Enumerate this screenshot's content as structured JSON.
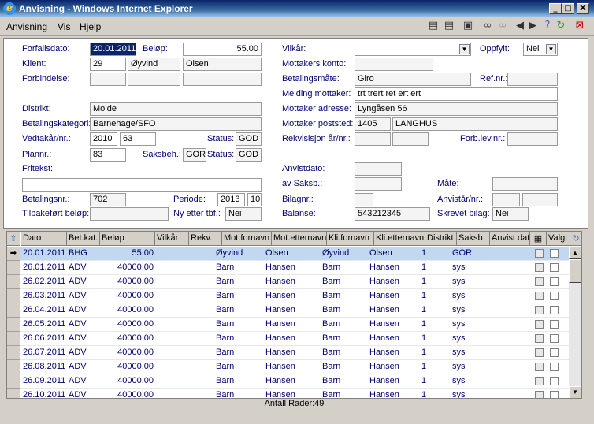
{
  "window": {
    "title": "Anvisning - Windows Internet Explorer",
    "min": "_",
    "max": "□",
    "close": "X"
  },
  "menu": [
    "Anvisning",
    "Vis",
    "Hjelp"
  ],
  "colors": {
    "label": "#00006e",
    "selected_row": "#c2d8f0"
  },
  "toolbar": {
    "icons": [
      "printer-icon",
      "printer-icon",
      "save-icon",
      "binoculars-icon",
      "binoculars-gray-icon",
      "prev-icon",
      "next-icon",
      "help-icon",
      "refresh-icon",
      "close-icon"
    ]
  },
  "form": {
    "l_forfallsdato": "Forfallsdato:",
    "forfallsdato": "20.01.2011",
    "l_belop": "Beløp:",
    "belop": "55.00",
    "l_vilkar": "Vilkår:",
    "vilkar": "",
    "l_oppfylt": "Oppfylt:",
    "oppfylt": "Nei",
    "l_klient": "Klient:",
    "klient_nr": "29",
    "klient_fornavn": "Øyvind",
    "klient_etternavn": "Olsen",
    "l_mottakers_konto": "Mottakers konto:",
    "mottakers_konto": "",
    "l_forbindelse": "Forbindelse:",
    "l_betalingsmate": "Betalingsmåte:",
    "betalingsmate": "Giro",
    "l_refnr": "Ref.nr.:",
    "refnr": "",
    "l_melding": "Melding mottaker:",
    "melding": "trt trert ret ert ert",
    "l_distrikt": "Distrikt:",
    "distrikt": "Molde",
    "l_mottaker_adresse": "Mottaker adresse:",
    "mottaker_adresse": "Lyngåsen 56",
    "l_betalingskategori": "Betalingskategori:",
    "betalingskategori": "Barnehage/SFO",
    "l_mottaker_poststed": "Mottaker poststed:",
    "postnr": "1405",
    "poststed": "LANGHUS",
    "l_vedtakar": "Vedtakår/nr.:",
    "vedtak_ar": "2010",
    "vedtak_nr": "63",
    "l_status": "Status:",
    "status1": "GOD",
    "l_rekvisisjon": "Rekvisisjon år/nr.:",
    "l_forblevnr": "Forb.lev.nr.:",
    "l_plannr": "Plannr.:",
    "plannr": "83",
    "l_saksbeh": "Saksbeh.:",
    "saksbeh": "GOR",
    "l_status2": "Status:",
    "status2": "GOD",
    "l_fritekst": "Fritekst:",
    "fritekst": "",
    "l_anvistdato": "Anvistdato:",
    "l_avsaksb": "av Saksb.:",
    "l_mate": "Måte:",
    "l_betalingsnr": "Betalingsnr.:",
    "betalingsnr": "702",
    "l_periode": "Periode:",
    "periode_ar": "2013",
    "periode_nr": "10",
    "l_bilagnr": "Bilagnr.:",
    "l_anvistar": "Anvistår/nr.:",
    "l_tilbakefort": "Tilbakeført beløp:",
    "l_nyetter": "Ny etter tbf.:",
    "nyetter": "Nei",
    "l_balanse": "Balanse:",
    "balanse": "543212345",
    "l_skrevet": "Skrevet bilag:",
    "skrevet": "Nei"
  },
  "grid": {
    "headers": [
      "Dato",
      "Bet.kat.",
      "Beløp",
      "Vilkår",
      "Rekv.",
      "Mot.fornavn",
      "Mot.etternavn",
      "Kli.fornavn",
      "Kli.etternavn",
      "Distrikt",
      "Saksb.",
      "Anvist dato",
      "Valgt"
    ],
    "rows": [
      [
        "20.01.2011",
        "BHG",
        "55.00",
        "",
        "",
        "Øyvind",
        "Olsen",
        "Øyvind",
        "Olsen",
        "1",
        "GOR"
      ],
      [
        "26.01.2011",
        "ADV",
        "40000.00",
        "",
        "",
        "Barn",
        "Hansen",
        "Barn",
        "Hansen",
        "1",
        "sys"
      ],
      [
        "26.02.2011",
        "ADV",
        "40000.00",
        "",
        "",
        "Barn",
        "Hansen",
        "Barn",
        "Hansen",
        "1",
        "sys"
      ],
      [
        "26.03.2011",
        "ADV",
        "40000.00",
        "",
        "",
        "Barn",
        "Hansen",
        "Barn",
        "Hansen",
        "1",
        "sys"
      ],
      [
        "26.04.2011",
        "ADV",
        "40000.00",
        "",
        "",
        "Barn",
        "Hansen",
        "Barn",
        "Hansen",
        "1",
        "sys"
      ],
      [
        "26.05.2011",
        "ADV",
        "40000.00",
        "",
        "",
        "Barn",
        "Hansen",
        "Barn",
        "Hansen",
        "1",
        "sys"
      ],
      [
        "26.06.2011",
        "ADV",
        "40000.00",
        "",
        "",
        "Barn",
        "Hansen",
        "Barn",
        "Hansen",
        "1",
        "sys"
      ],
      [
        "26.07.2011",
        "ADV",
        "40000.00",
        "",
        "",
        "Barn",
        "Hansen",
        "Barn",
        "Hansen",
        "1",
        "sys"
      ],
      [
        "26.08.2011",
        "ADV",
        "40000.00",
        "",
        "",
        "Barn",
        "Hansen",
        "Barn",
        "Hansen",
        "1",
        "sys"
      ],
      [
        "26.09.2011",
        "ADV",
        "40000.00",
        "",
        "",
        "Barn",
        "Hansen",
        "Barn",
        "Hansen",
        "1",
        "sys"
      ],
      [
        "26.10.2011",
        "ADV",
        "40000.00",
        "",
        "",
        "Barn",
        "Hansen",
        "Barn",
        "Hansen",
        "1",
        "sys"
      ]
    ],
    "status": "Antall Rader:49"
  }
}
